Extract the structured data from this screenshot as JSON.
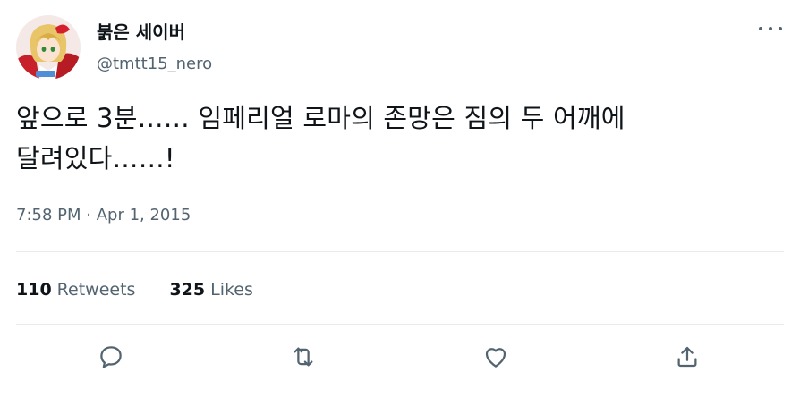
{
  "tweet": {
    "author": {
      "display_name": "붉은 세이버",
      "handle": "@tmtt15_nero"
    },
    "text": "앞으로 3분…… 임페리얼 로마의 존망은 짐의 두 어깨에\n달려있다……!",
    "time": "7:58 PM",
    "separator": " · ",
    "date": "Apr 1, 2015"
  },
  "stats": {
    "retweets": {
      "count": "110",
      "label": "Retweets"
    },
    "likes": {
      "count": "325",
      "label": "Likes"
    }
  },
  "actions": [
    "reply-icon",
    "retweet-icon",
    "like-icon",
    "share-icon"
  ],
  "colors": {
    "text": "#0f1419",
    "secondary": "#536471",
    "divider": "#e7e9ea"
  }
}
